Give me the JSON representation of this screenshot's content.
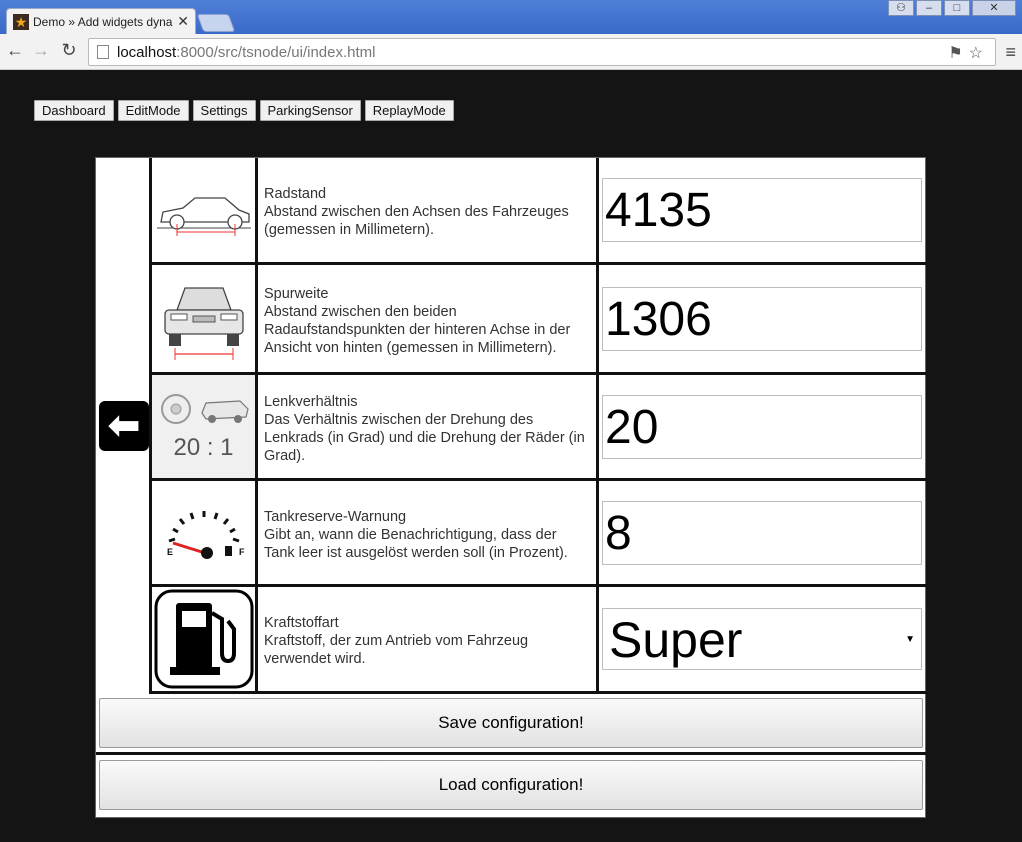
{
  "browser": {
    "tab_title": "Demo » Add widgets dyna",
    "url_host": "localhost",
    "url_path": ":8000/src/tsnode/ui/index.html"
  },
  "nav": {
    "items": [
      "Dashboard",
      "EditMode",
      "Settings",
      "ParkingSensor",
      "ReplayMode"
    ]
  },
  "settings": [
    {
      "title": "Radstand",
      "description": "Abstand zwischen den Achsen des Fahrzeuges (gemessen in Millimetern).",
      "value": "4135",
      "icon": "car-side-wheelbase-icon"
    },
    {
      "title": "Spurweite",
      "description": "Abstand zwischen den beiden Radaufstandspunkten der hinteren Achse in der Ansicht von hinten (gemessen in Millimetern).",
      "value": "1306",
      "icon": "car-rear-track-icon"
    },
    {
      "title": "Lenkverhältnis",
      "description": "Das Verhältnis zwischen der Drehung des Lenkrads (in Grad) und die Drehung der Räder (in Grad).",
      "value": "20",
      "icon": "steering-ratio-icon",
      "icon_ratio": "20 : 1"
    },
    {
      "title": "Tankreserve-Warnung",
      "description": "Gibt an, wann die Benachrichtigung, dass der Tank leer ist ausgelöst werden soll (in Prozent).",
      "value": "8",
      "icon": "fuel-gauge-icon",
      "gauge_e": "E",
      "gauge_f": "F"
    },
    {
      "title": "Kraftstoffart",
      "description": "Kraftstoff, der zum Antrieb vom Fahrzeug verwendet wird.",
      "value": "Super",
      "icon": "fuel-pump-icon"
    }
  ],
  "actions": {
    "save_label": "Save configuration!",
    "load_label": "Load configuration!"
  }
}
